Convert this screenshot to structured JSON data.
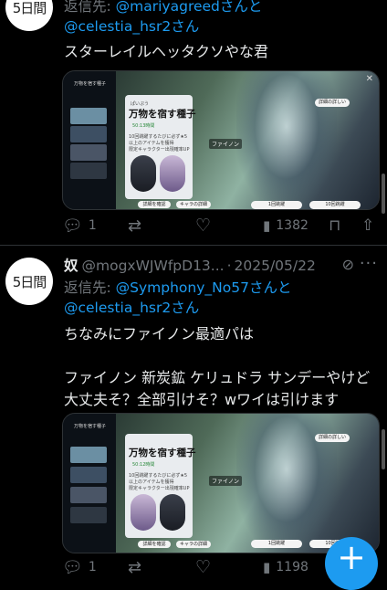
{
  "tweet1": {
    "avatar_text": "5日間",
    "reply_prefix": "返信先: ",
    "reply_user1": "@mariyagreed",
    "reply_join": "さんと",
    "reply_user2": "@celestia_hsr2",
    "reply_suffix": "さん",
    "text": "スターレイルヘッタクソやな君",
    "media": {
      "header_label": "万物を宿す種子",
      "banner": "ぱいぷう",
      "panel_title": "万物を宿す種子",
      "tag": "50:13時間",
      "desc1": "10回跳躍するたびに必ず★5",
      "desc2": "以上のアイテムを獲得",
      "desc3": "限定キャラクター出現確率UP",
      "btn_detail": "詳細を確認",
      "btn_view": "キャラの詳細",
      "char_name": "ファイノン",
      "btn_one": "1回跳躍",
      "btn_ten": "10回跳躍",
      "top_right": "詳細の詳しい"
    },
    "stats": {
      "replies": "1",
      "retweets": "",
      "likes": "",
      "views": "1382"
    }
  },
  "tweet2": {
    "avatar_text": "5日間",
    "name": "奴",
    "handle": "@mogxWJWfpD13...",
    "sep": "·",
    "date": "2025/05/22",
    "reply_prefix": "返信先: ",
    "reply_user1": "@Symphony_No57",
    "reply_join": "さんと",
    "reply_user2": "@celestia_hsr2",
    "reply_suffix": "さん",
    "text": "ちなみにファイノン最適パは\n\nファイノン 新炭鉱 ケリュドラ サンデーやけど\n大丈夫そ？全部引けそ？wワイは引けます",
    "media": {
      "header_label": "万物を宿す種子",
      "panel_title": "万物を宿す種子",
      "tag": "50:12時間",
      "desc1": "10回跳躍するたびに必ず★5",
      "desc2": "以上のアイテムを獲得",
      "desc3": "限定キャラクター出現確率UP",
      "btn_detail": "詳細を確認",
      "btn_view": "キャラの詳細",
      "char_name": "ファイノン",
      "btn_one": "1回跳躍",
      "btn_ten": "10回跳躍",
      "top_right": "詳細の詳しい"
    },
    "stats": {
      "replies": "1",
      "retweets": "",
      "likes": "",
      "views": "1198"
    }
  },
  "fab_label": "+"
}
